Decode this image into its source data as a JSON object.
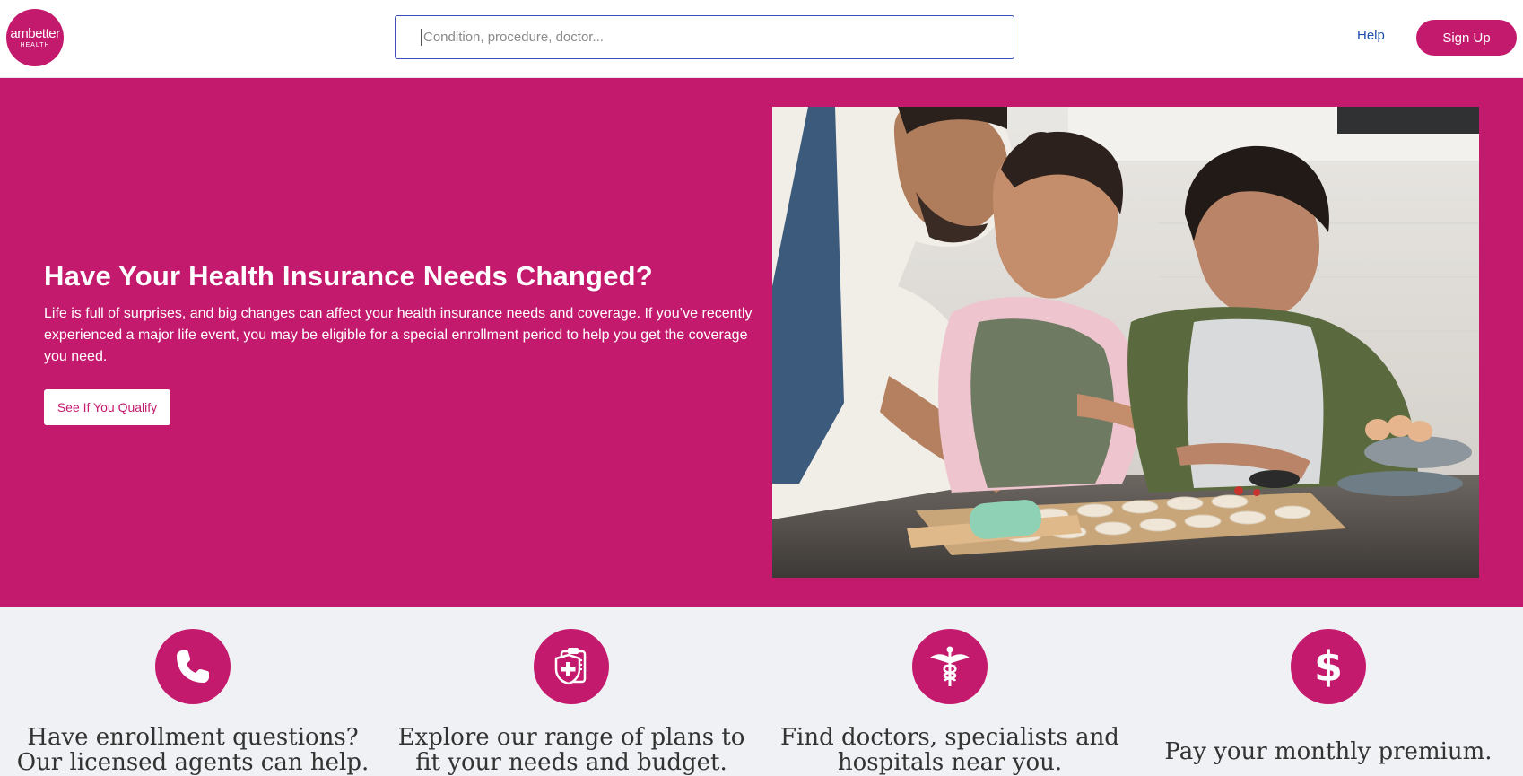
{
  "header": {
    "logo_line1": "ambetter",
    "logo_line2": "HEALTH",
    "search_placeholder": "Condition, procedure, doctor...",
    "search_value": "",
    "help_label": "Help",
    "signup_label": "Sign Up"
  },
  "hero": {
    "title": "Have Your Health Insurance Needs Changed?",
    "body": "Life is full of surprises, and big changes can affect your health insurance needs and coverage. If you’ve recently experienced a major life event, you may be eligible for a special enrollment period to help you get the coverage you need.",
    "cta_label": "See If You Qualify"
  },
  "features": [
    {
      "icon": "phone-icon",
      "text": "Have enrollment questions? Our licensed agents can help."
    },
    {
      "icon": "shield-clipboard-icon",
      "text": "Explore our range of plans to fit your needs and budget."
    },
    {
      "icon": "caduceus-icon",
      "text": "Find doctors, specialists and hospitals near you."
    },
    {
      "icon": "dollar-icon",
      "text": "Pay your monthly premium."
    }
  ],
  "colors": {
    "brand": "#c41a6e",
    "link": "#1f4fa8",
    "search_border": "#3a4fb8",
    "feature_bg": "#f0f1f5"
  }
}
